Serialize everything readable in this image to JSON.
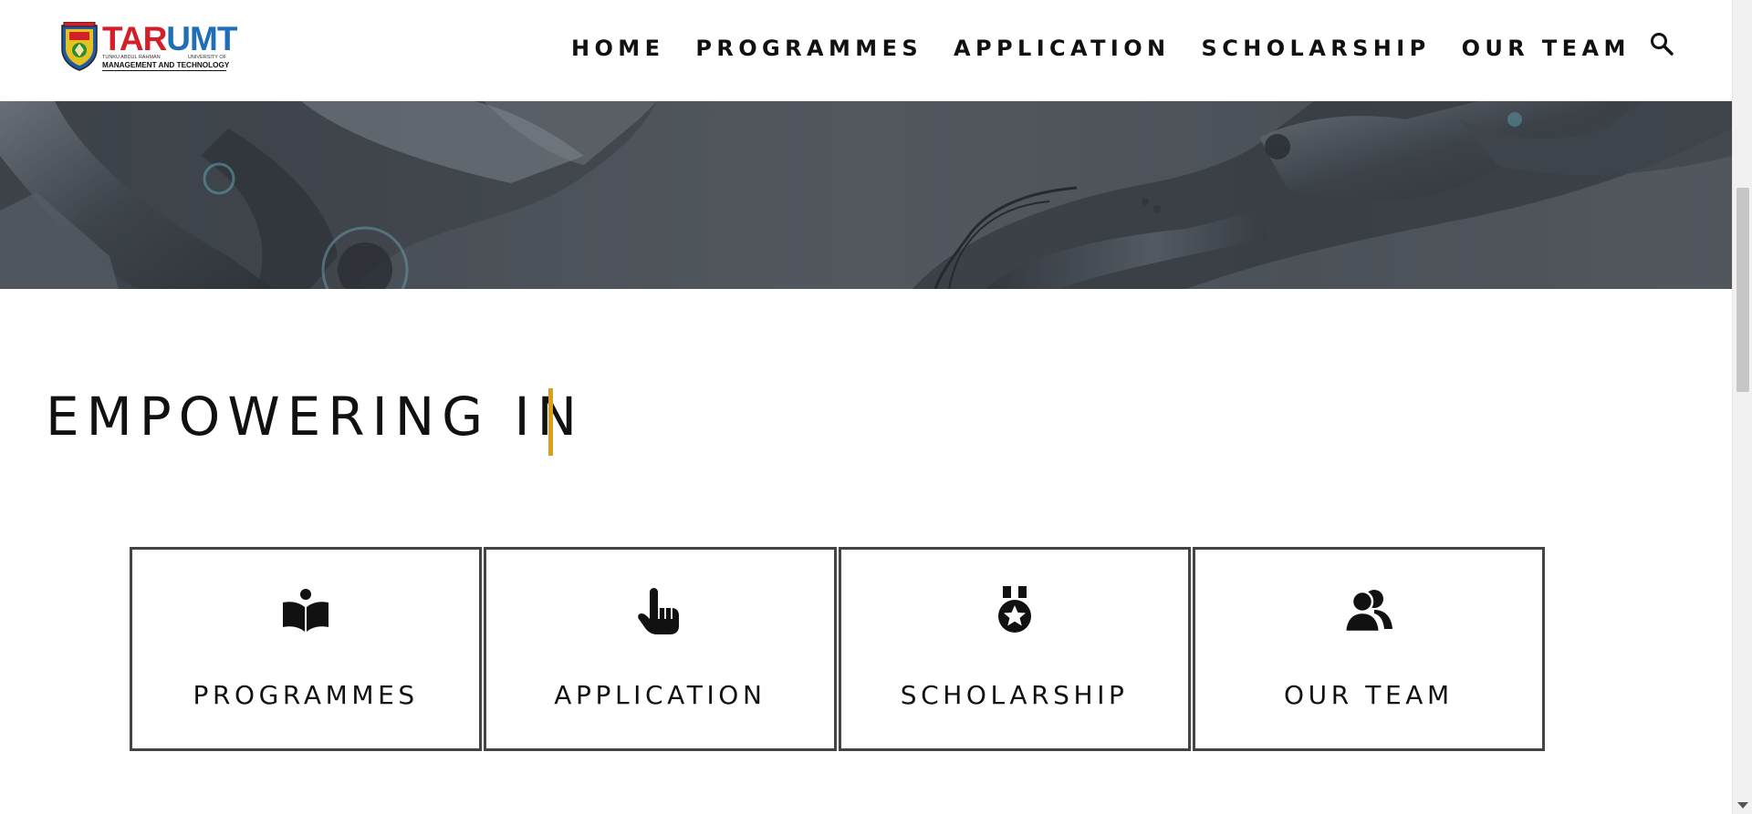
{
  "header": {
    "logo": {
      "brand_main_red": "TAR",
      "brand_main_blue": "UMT",
      "sub_left": "TUNKU ABDUL RAHMAN",
      "sub_right": "UNIVERSITY OF",
      "tagline": "MANAGEMENT AND TECHNOLOGY"
    },
    "nav": [
      {
        "label": "HOME"
      },
      {
        "label": "PROGRAMMES"
      },
      {
        "label": "APPLICATION"
      },
      {
        "label": "SCHOLARSHIP"
      },
      {
        "label": "OUR TEAM"
      }
    ],
    "search_icon": "search-icon"
  },
  "banner": {
    "image": "robot-arms-banner"
  },
  "hero": {
    "headline": "EMPOWERING IN"
  },
  "cards": [
    {
      "label": "PROGRAMMES",
      "icon": "book-reader-icon"
    },
    {
      "label": "APPLICATION",
      "icon": "pointing-hand-icon"
    },
    {
      "label": "SCHOLARSHIP",
      "icon": "medal-icon"
    },
    {
      "label": "OUR TEAM",
      "icon": "team-icon"
    }
  ],
  "colors": {
    "accent_cursor": "#d9a020",
    "brand_red": "#d41f2b",
    "brand_blue": "#1f6fb6",
    "banner_overlay": "#4f555c",
    "card_border": "#444444"
  }
}
